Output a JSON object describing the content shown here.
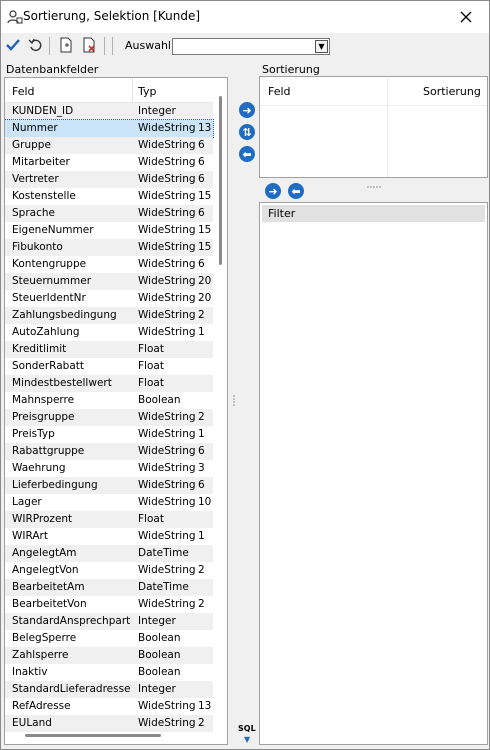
{
  "window": {
    "title": "Sortierung, Selektion [Kunde]"
  },
  "toolbar": {
    "auswahl_label": "Auswahl",
    "auswahl_value": ""
  },
  "left_panel": {
    "label": "Datenbankfelder",
    "columns": [
      "Feld",
      "Typ"
    ],
    "rows": [
      {
        "field": "KUNDEN_ID",
        "type": "Integer",
        "len": ""
      },
      {
        "field": "Nummer",
        "type": "WideString",
        "len": "13"
      },
      {
        "field": "Gruppe",
        "type": "WideString",
        "len": "6"
      },
      {
        "field": "Mitarbeiter",
        "type": "WideString",
        "len": "6"
      },
      {
        "field": "Vertreter",
        "type": "WideString",
        "len": "6"
      },
      {
        "field": "Kostenstelle",
        "type": "WideString",
        "len": "15"
      },
      {
        "field": "Sprache",
        "type": "WideString",
        "len": "6"
      },
      {
        "field": "EigeneNummer",
        "type": "WideString",
        "len": "15"
      },
      {
        "field": "Fibukonto",
        "type": "WideString",
        "len": "15"
      },
      {
        "field": "Kontengruppe",
        "type": "WideString",
        "len": "6"
      },
      {
        "field": "Steuernummer",
        "type": "WideString",
        "len": "20"
      },
      {
        "field": "SteuerIdentNr",
        "type": "WideString",
        "len": "20"
      },
      {
        "field": "Zahlungsbedingung",
        "type": "WideString",
        "len": "2"
      },
      {
        "field": "AutoZahlung",
        "type": "WideString",
        "len": "1"
      },
      {
        "field": "Kreditlimit",
        "type": "Float",
        "len": ""
      },
      {
        "field": "SonderRabatt",
        "type": "Float",
        "len": ""
      },
      {
        "field": "Mindestbestellwert",
        "type": "Float",
        "len": ""
      },
      {
        "field": "Mahnsperre",
        "type": "Boolean",
        "len": ""
      },
      {
        "field": "Preisgruppe",
        "type": "WideString",
        "len": "2"
      },
      {
        "field": "PreisTyp",
        "type": "WideString",
        "len": "1"
      },
      {
        "field": "Rabattgruppe",
        "type": "WideString",
        "len": "6"
      },
      {
        "field": "Waehrung",
        "type": "WideString",
        "len": "3"
      },
      {
        "field": "Lieferbedingung",
        "type": "WideString",
        "len": "6"
      },
      {
        "field": "Lager",
        "type": "WideString",
        "len": "10"
      },
      {
        "field": "WIRProzent",
        "type": "Float",
        "len": ""
      },
      {
        "field": "WIRArt",
        "type": "WideString",
        "len": "1"
      },
      {
        "field": "AngelegtAm",
        "type": "DateTime",
        "len": ""
      },
      {
        "field": "AngelegtVon",
        "type": "WideString",
        "len": "2"
      },
      {
        "field": "BearbeitetAm",
        "type": "DateTime",
        "len": ""
      },
      {
        "field": "BearbeitetVon",
        "type": "WideString",
        "len": "2"
      },
      {
        "field": "StandardAnsprechpart...",
        "type": "Integer",
        "len": ""
      },
      {
        "field": "BelegSperre",
        "type": "Boolean",
        "len": ""
      },
      {
        "field": "Zahlsperre",
        "type": "Boolean",
        "len": ""
      },
      {
        "field": "Inaktiv",
        "type": "Boolean",
        "len": ""
      },
      {
        "field": "StandardLieferadresse",
        "type": "Integer",
        "len": ""
      },
      {
        "field": "RefAdresse",
        "type": "WideString",
        "len": "13"
      },
      {
        "field": "EULand",
        "type": "WideString",
        "len": "2"
      }
    ]
  },
  "sort_panel": {
    "label": "Sortierung",
    "columns": [
      "Feld",
      "Sortierung"
    ]
  },
  "filter_panel": {
    "header": "Filter"
  },
  "sql_label": "SQL",
  "colors": {
    "accent": "#1f6cc2",
    "selection": "#cce4f7",
    "check": "#1f5fbf"
  }
}
